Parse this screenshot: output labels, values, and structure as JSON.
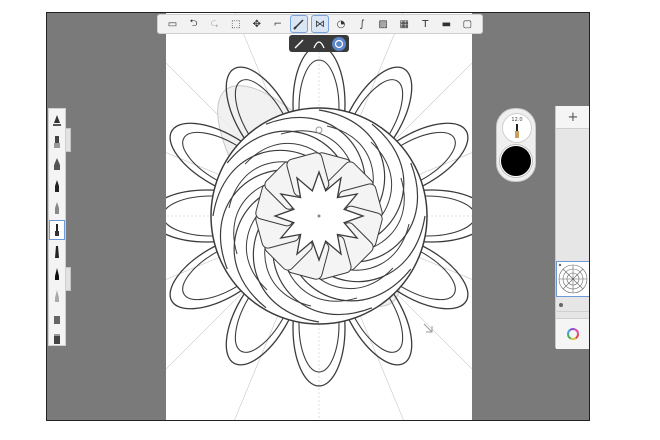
{
  "toolbar": {
    "items": [
      {
        "name": "gallery",
        "glyph": "▭"
      },
      {
        "name": "undo",
        "glyph": "⮌"
      },
      {
        "name": "redo",
        "glyph": "⮎"
      },
      {
        "name": "selection",
        "glyph": "⬚"
      },
      {
        "name": "transform",
        "glyph": "✥"
      },
      {
        "name": "crop",
        "glyph": "⌐"
      },
      {
        "name": "guides",
        "glyph": "⊘"
      },
      {
        "name": "symmetry",
        "glyph": "⋈"
      },
      {
        "name": "shapes",
        "glyph": "◔"
      },
      {
        "name": "curve",
        "glyph": "∫"
      },
      {
        "name": "image",
        "glyph": "▨"
      },
      {
        "name": "perspective",
        "glyph": "▦"
      },
      {
        "name": "text",
        "glyph": "T"
      },
      {
        "name": "video",
        "glyph": "▬"
      },
      {
        "name": "fullscreen",
        "glyph": "▢"
      }
    ]
  },
  "brush_settings": {
    "size_value": "12.0",
    "current_color": "#000000"
  },
  "layers": {
    "add_label": "+"
  },
  "colors": {
    "accent": "#6d9ad6",
    "background_gray": "#7a7a7a",
    "stroke": "#3c3c3c"
  }
}
